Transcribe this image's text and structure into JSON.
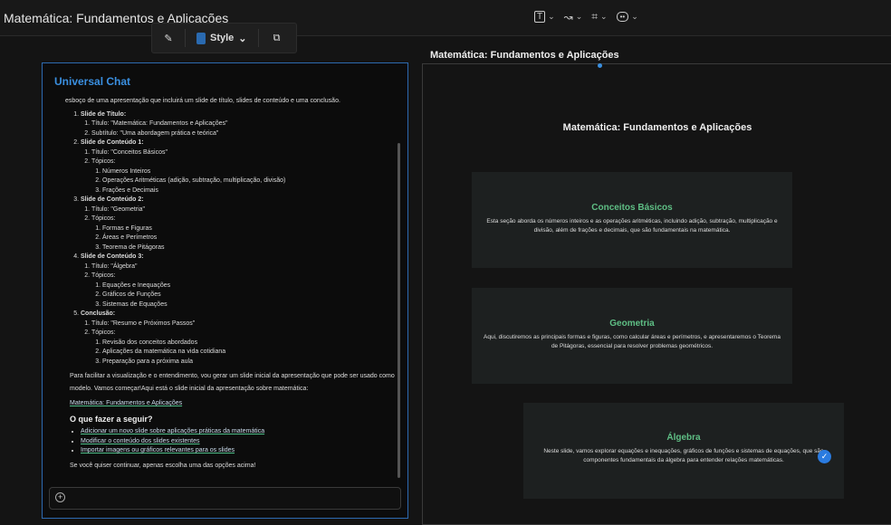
{
  "app": {
    "title": "Matemática: Fundamentos e Aplicações"
  },
  "toolbar": {
    "tools": [
      {
        "icon": "text-icon",
        "glyph": "T"
      },
      {
        "icon": "connector-icon",
        "glyph": "↝"
      },
      {
        "icon": "frame-icon",
        "glyph": "⌗"
      },
      {
        "icon": "comment-icon",
        "glyph": "💬"
      }
    ]
  },
  "floatbar": {
    "style_label": "Style",
    "style_color": "#2a6ab0"
  },
  "chat": {
    "title": "Universal Chat",
    "intro": "esboço de uma apresentação que incluirá um slide de título, slides de conteúdo e uma conclusão.",
    "outline": [
      {
        "label": "Slide de Título:",
        "items": [
          {
            "label": "Título: \"Matemática: Fundamentos e Aplicações\""
          },
          {
            "label": "Subtítulo: \"Uma abordagem prática e teórica\""
          }
        ]
      },
      {
        "label": "Slide de Conteúdo 1:",
        "items": [
          {
            "label": "Título: \"Conceitos Básicos\""
          },
          {
            "label": "Tópicos:",
            "items": [
              {
                "label": "Números Inteiros"
              },
              {
                "label": "Operações Aritméticas (adição, subtração, multiplicação, divisão)"
              },
              {
                "label": "Frações e Decimais"
              }
            ]
          }
        ]
      },
      {
        "label": "Slide de Conteúdo 2:",
        "items": [
          {
            "label": "Título: \"Geometria\""
          },
          {
            "label": "Tópicos:",
            "items": [
              {
                "label": "Formas e Figuras"
              },
              {
                "label": "Áreas e Perímetros"
              },
              {
                "label": "Teorema de Pitágoras"
              }
            ]
          }
        ]
      },
      {
        "label": "Slide de Conteúdo 3:",
        "items": [
          {
            "label": "Título: \"Álgebra\""
          },
          {
            "label": "Tópicos:",
            "items": [
              {
                "label": "Equações e Inequações"
              },
              {
                "label": "Gráficos de Funções"
              },
              {
                "label": "Sistemas de Equações"
              }
            ]
          }
        ]
      },
      {
        "label": "Conclusão:",
        "items": [
          {
            "label": "Título: \"Resumo e Próximos Passos\""
          },
          {
            "label": "Tópicos:",
            "items": [
              {
                "label": "Revisão dos conceitos abordados"
              },
              {
                "label": "Aplicações da matemática na vida cotidiana"
              },
              {
                "label": "Preparação para a próxima aula"
              }
            ]
          }
        ]
      }
    ],
    "paragraph": "Para facilitar a visualização e o entendimento, vou gerar um slide inicial da apresentação que pode ser usado como modelo. Vamos começar!Aqui está o slide inicial da apresentação sobre matemática:",
    "link": "Matemática: Fundamentos e Aplicações",
    "next_heading": "O que fazer a seguir?",
    "suggestions": [
      "Adicionar um novo slide sobre aplicações práticas da matemática",
      "Modificar o conteúdo dos slides existentes",
      "Importar imagens ou gráficos relevantes para os slides"
    ],
    "closing": "Se você quiser continuar, apenas escolha uma das opções acima!",
    "input_placeholder": ""
  },
  "canvas": {
    "frame_label": "Matemática: Fundamentos e Aplicações",
    "title": "Matemática: Fundamentos e Aplicações",
    "slides": [
      {
        "title": "Conceitos Básicos",
        "text": "Esta seção aborda os números inteiros e as operações aritméticas, incluindo adição, subtração, multiplicação e divisão, além de frações e decimais, que são fundamentais na matemática."
      },
      {
        "title": "Geometria",
        "text": "Aqui, discutiremos as principais formas e figuras, como calcular áreas e perímetros, e apresentaremos o Teorema de Pitágoras, essencial para resolver problemas geométricos."
      },
      {
        "title": "Álgebra",
        "text": "Neste slide, vamos explorar equações e inequações, gráficos de funções e sistemas de equações, que são componentes fundamentais da álgebra para entender relações matemáticas."
      }
    ],
    "accent": "#5fbf85"
  }
}
